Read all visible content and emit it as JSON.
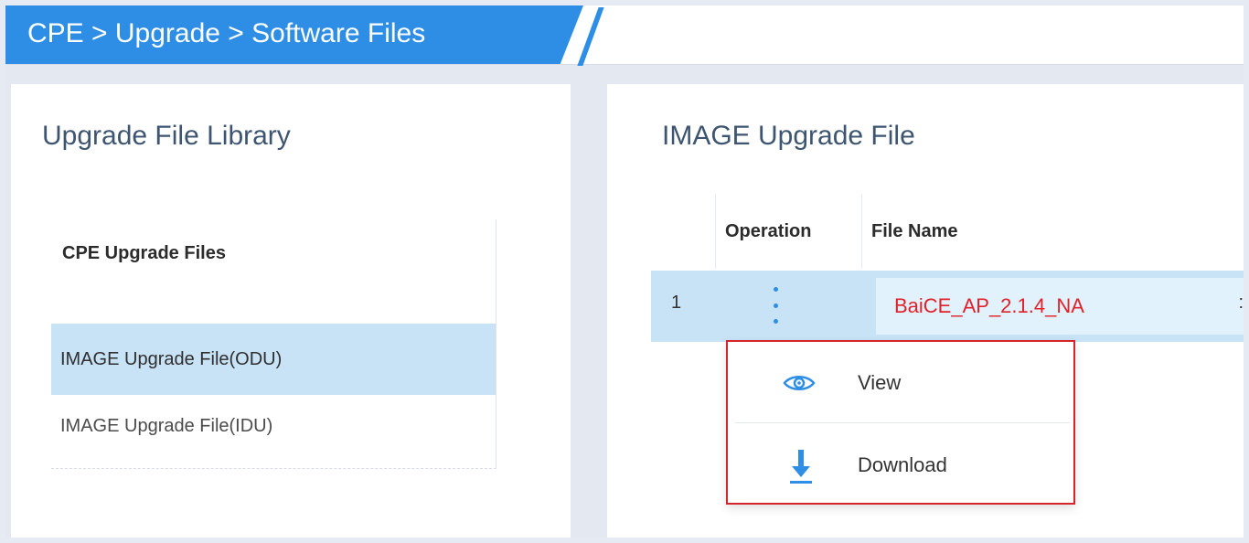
{
  "header": {
    "breadcrumb": "CPE > Upgrade > Software Files"
  },
  "left_panel": {
    "title": "Upgrade File Library",
    "list_header": "CPE Upgrade Files",
    "items": [
      {
        "label": "IMAGE Upgrade File(ODU)",
        "selected": true
      },
      {
        "label": "IMAGE Upgrade File(IDU)",
        "selected": false
      }
    ]
  },
  "right_panel": {
    "title": "IMAGE Upgrade File",
    "table": {
      "columns": [
        "Operation",
        "File Name"
      ],
      "rows": [
        {
          "index": "1",
          "file_name": "BaiCE_AP_2.1.4_NA",
          "extra": ":"
        }
      ]
    }
  },
  "dropdown": {
    "items": [
      {
        "label": "View",
        "icon": "eye-icon"
      },
      {
        "label": "Download",
        "icon": "download-icon"
      }
    ]
  },
  "colors": {
    "accent": "#2e8ee6",
    "selected_row": "#c8e2f6",
    "filename_red": "#e0212a",
    "highlight_border": "#d6242c"
  }
}
